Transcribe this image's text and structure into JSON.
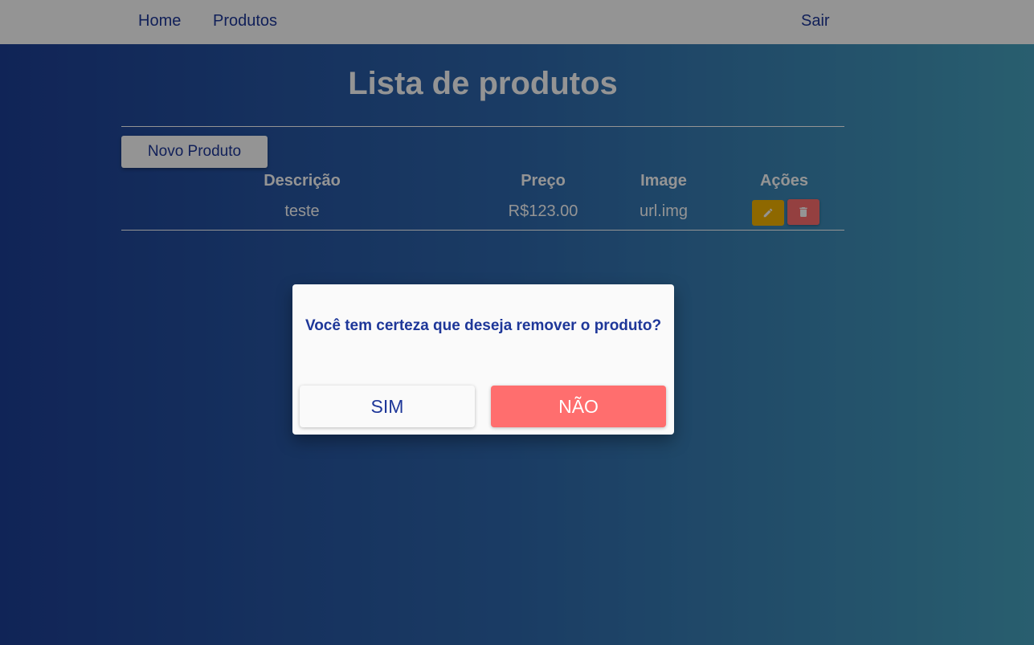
{
  "nav": {
    "home": "Home",
    "produtos": "Produtos",
    "sair": "Sair"
  },
  "main": {
    "title": "Lista de produtos",
    "new_button": "Novo Produto",
    "table": {
      "headers": [
        "Descrição",
        "Preço",
        "Image",
        "Ações"
      ],
      "rows": [
        {
          "descricao": "teste",
          "preco": "R$123.00",
          "image": "url.img"
        }
      ]
    },
    "icons": {
      "edit": "pencil-icon",
      "delete": "trash-icon"
    }
  },
  "modal": {
    "message": "Você tem certeza que deseja remover o produto?",
    "confirm": "SIM",
    "cancel": "NÃO"
  },
  "colors": {
    "primary": "#1e3799",
    "edit": "#f5b400",
    "danger": "#ff6e6e",
    "background_start": "#1d3f96",
    "background_end": "#47a3bf"
  }
}
